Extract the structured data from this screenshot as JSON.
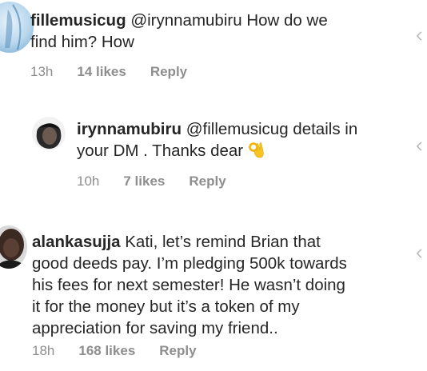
{
  "comments": [
    {
      "username": "fillemusicug",
      "mention": "@irynnamubiru",
      "text_line1": " How do we",
      "text_line2": "find him?  How",
      "time": "13h",
      "likes": "14 likes",
      "reply": "Reply"
    },
    {
      "username": "irynnamubiru",
      "mention": "@fillemusicug",
      "text_line1": " details in",
      "text_line2": "your  DM . Thanks dear ",
      "emoji": "ok-hand-emoji",
      "time": "10h",
      "likes": "7 likes",
      "reply": "Reply"
    },
    {
      "username": "alankasujja",
      "text_line1": " Kati, let’s remind Brian that",
      "text_line2": "good deeds pay. I’m pledging 500k towards",
      "text_line3": "his fees for next semester!  He wasn’t doing",
      "text_line4": "it for the money but it’s a token of my",
      "text_line5": "appreciation for saving my friend..",
      "time": "18h",
      "likes": "168 likes",
      "reply": "Reply"
    }
  ],
  "icons": {
    "like": "heart-outline-icon"
  }
}
